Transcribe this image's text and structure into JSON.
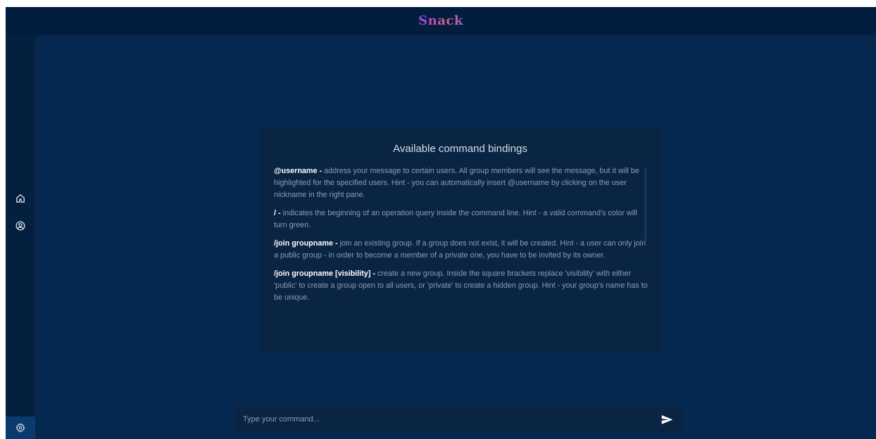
{
  "app": {
    "logo": "Snack"
  },
  "sidebar": {
    "items": [
      {
        "icon": "home-icon"
      },
      {
        "icon": "account-circle-icon"
      }
    ],
    "settings_icon": "gear-icon"
  },
  "help_panel": {
    "title": "Available command bindings",
    "commands": [
      {
        "name": "@username -",
        "description": " address your message to certain users. All group members will see the message, but it will be highlighted for the specified users. Hint - you can automatically insert @username by clicking on the user nickname in the right pane."
      },
      {
        "name": "/ -",
        "description": " indicates the beginning of an operation query inside the command line. Hint - a valid command's color will turn green."
      },
      {
        "name": "/join groupname -",
        "description": " join an existing group. If a group does not exist, it will be created. Hint - a user can only join a public group - in order to become a member of a private one, you have to be invited by its owner."
      },
      {
        "name": "/join groupname [visibility] -",
        "description": " create a new group. Inside the square brackets replace 'visibility' with either 'public' to create a group open to all users, or 'private' to create a hidden group. Hint - your group's name has to be unique."
      }
    ]
  },
  "command_bar": {
    "placeholder": "Type your command...",
    "value": "",
    "send_icon": "send-icon"
  },
  "colors": {
    "background": "#04284f",
    "topbar": "#021d3e",
    "sidebar": "#03213f",
    "panel": "#0a2544",
    "settings_active": "#0a3a6e",
    "text_muted": "#8e9bb0"
  }
}
